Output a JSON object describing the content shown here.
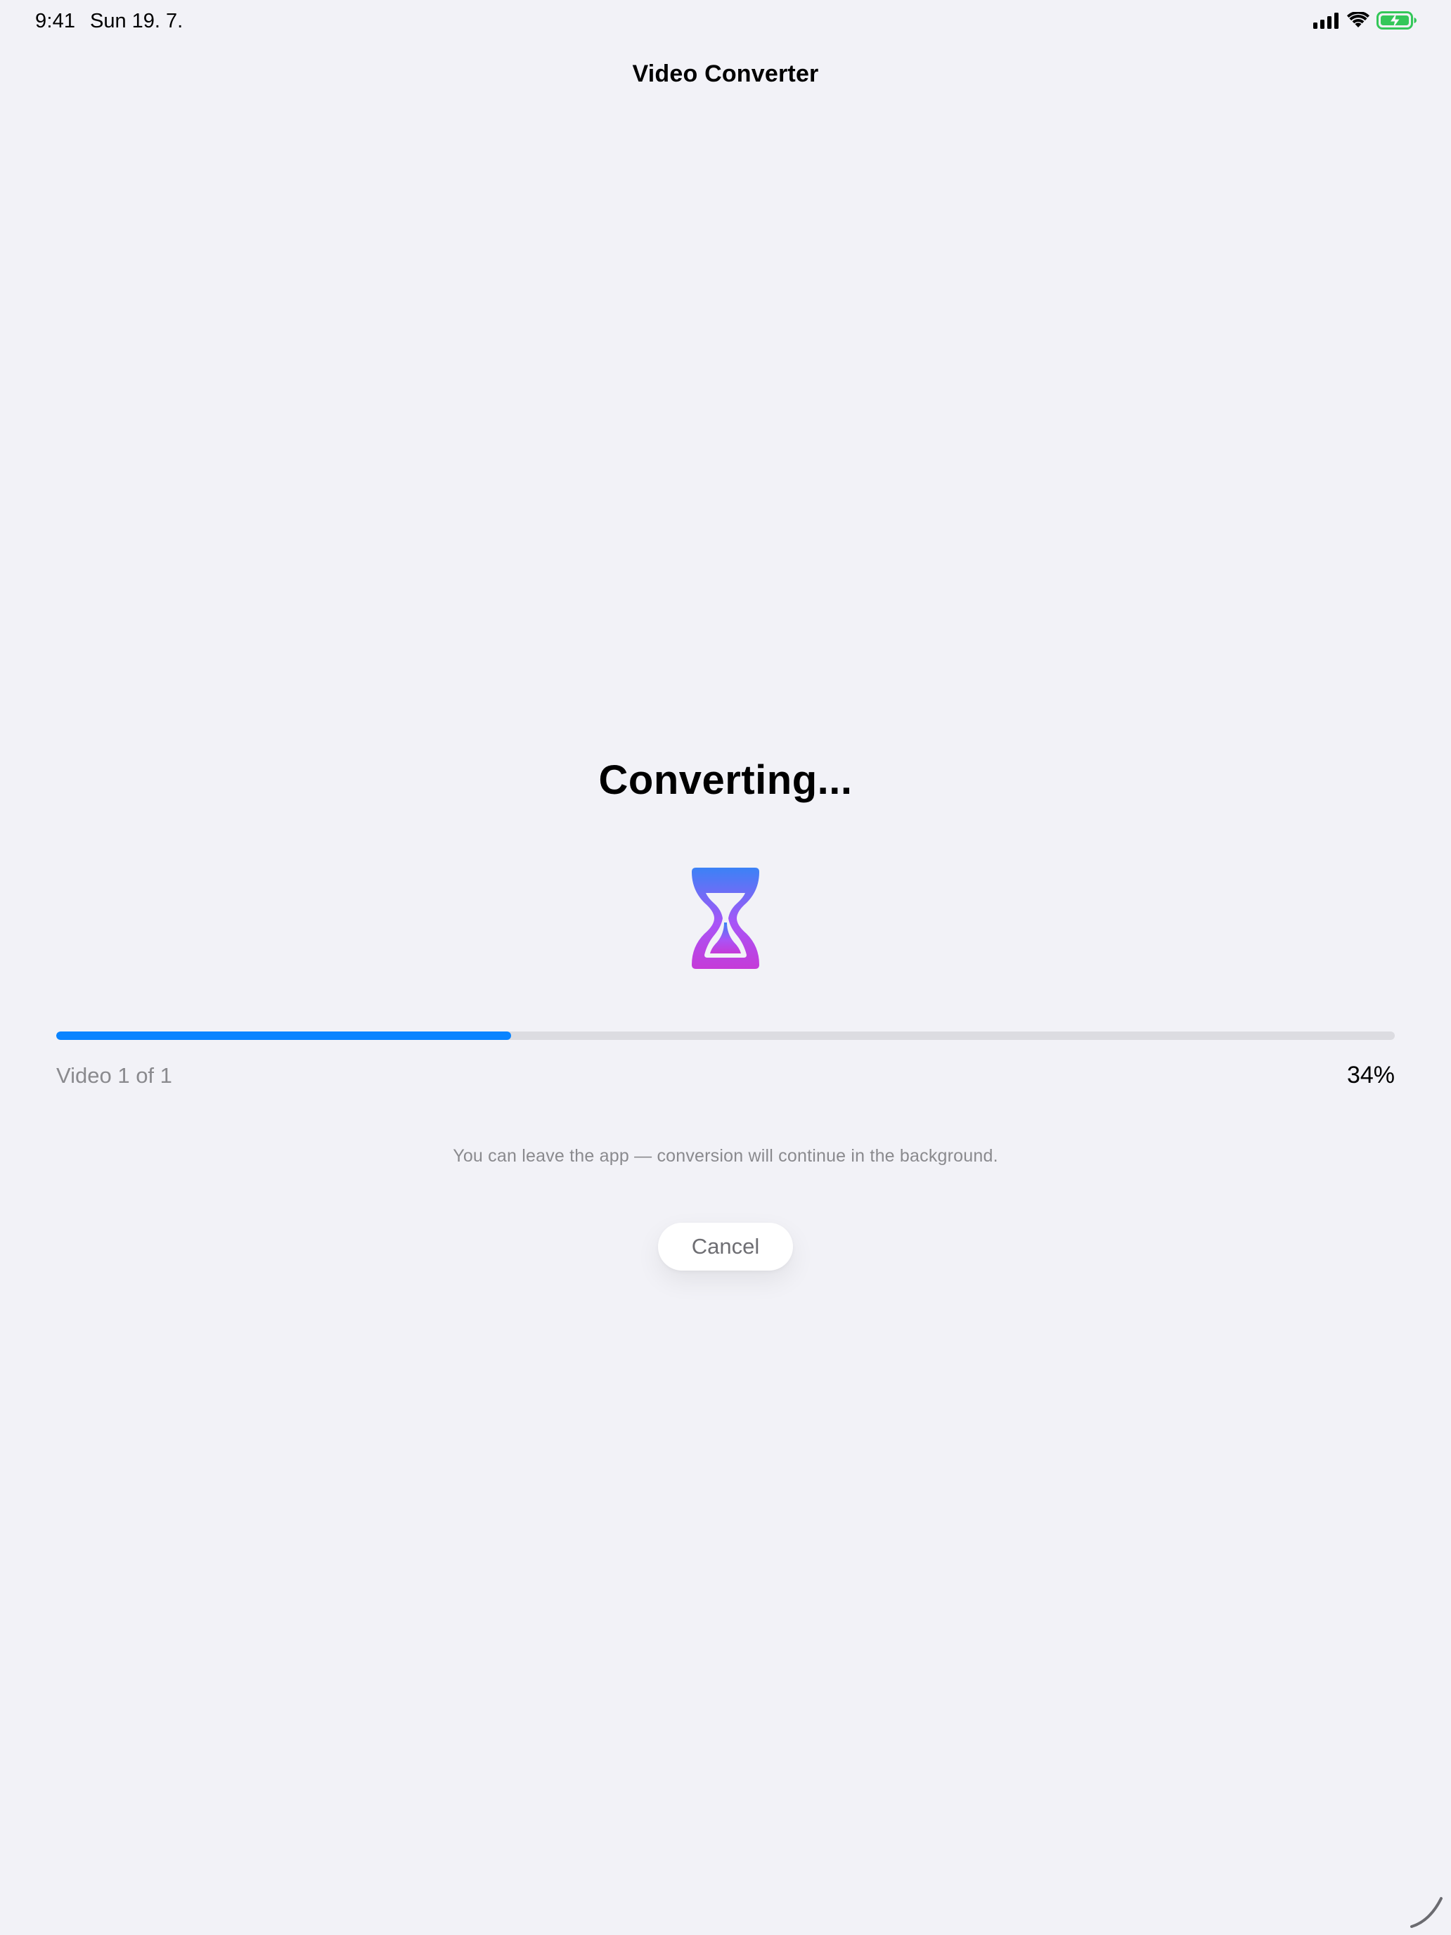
{
  "status_bar": {
    "time": "9:41",
    "date": "Sun 19. 7.",
    "icons": [
      "cellular-signal-icon",
      "wifi-icon",
      "battery-charging-icon"
    ],
    "battery_color": "#34c759"
  },
  "navigation": {
    "title": "Video Converter"
  },
  "conversion": {
    "heading": "Converting...",
    "icon": "hourglass-icon",
    "icon_gradient": [
      "#3b82f6",
      "#a855f7",
      "#c53ad8"
    ],
    "progress_fraction": 0.34,
    "progress_color": "#0a84ff",
    "item_label": "Video 1 of 1",
    "percent_label": "34%",
    "hint": "You can leave the app — conversion will continue in the background.",
    "cancel_label": "Cancel"
  },
  "colors": {
    "background": "#f2f2f7",
    "secondary_text": "#8a8a8e"
  }
}
